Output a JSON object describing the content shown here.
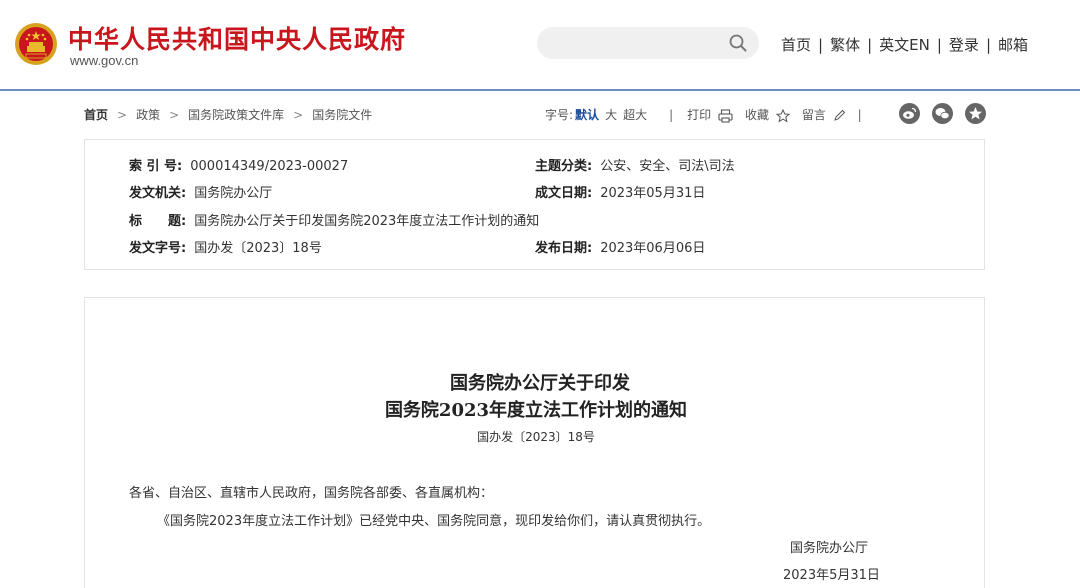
{
  "header": {
    "site_title": "中华人民共和国中央人民政府",
    "site_url": "www.gov.cn",
    "search_placeholder": "",
    "nav": [
      "首页",
      "繁体",
      "英文EN",
      "登录",
      "邮箱"
    ]
  },
  "breadcrumb": [
    "首页",
    "政策",
    "国务院政策文件库",
    "国务院文件"
  ],
  "tools": {
    "font_label": "字号:",
    "font_default": "默认",
    "font_large": "大",
    "font_xlarge": "超大",
    "print": "打印",
    "favorite": "收藏",
    "comment": "留言"
  },
  "meta": {
    "index_label": "索 引 号:",
    "index_value": "000014349/2023-00027",
    "category_label": "主题分类:",
    "category_value": "公安、安全、司法\\司法",
    "issuer_label": "发文机关:",
    "issuer_value": "国务院办公厅",
    "written_label": "成文日期:",
    "written_value": "2023年05月31日",
    "title_label": "标　　题:",
    "title_value": "国务院办公厅关于印发国务院2023年度立法工作计划的通知",
    "docno_label": "发文字号:",
    "docno_value": "国办发〔2023〕18号",
    "published_label": "发布日期:",
    "published_value": "2023年06月06日"
  },
  "article": {
    "title_line1": "国务院办公厅关于印发",
    "title_line2": "国务院2023年度立法工作计划的通知",
    "doc_number": "国办发〔2023〕18号",
    "salutation": "各省、自治区、直辖市人民政府，国务院各部委、各直属机构：",
    "body": "《国务院2023年度立法工作计划》已经党中央、国务院同意，现印发给你们，请认真贯彻执行。",
    "signer": "国务院办公厅",
    "date": "2023年5月31日"
  },
  "colors": {
    "brand_red": "#c9161d",
    "header_line": "#6d8fbf",
    "accent_blue": "#1a4b9b"
  }
}
